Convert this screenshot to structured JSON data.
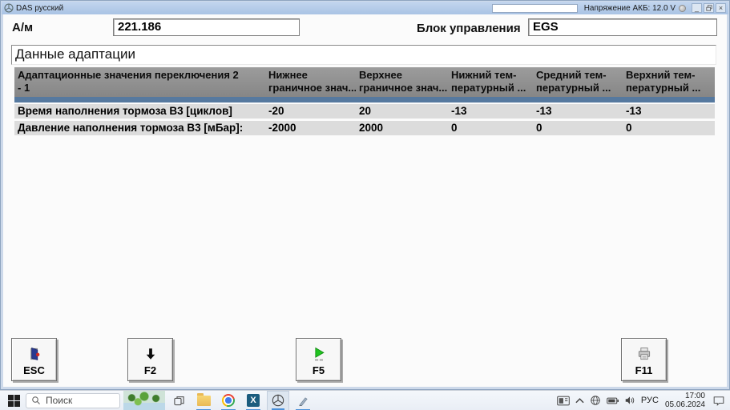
{
  "window": {
    "title": "DAS русский",
    "voltage": "Напряжение АКБ: 12.0 V",
    "minimize": "_",
    "close": "×"
  },
  "form": {
    "vehicle_label": "А/м",
    "vehicle_value": "221.186",
    "ecu_label": "Блок управления",
    "ecu_value": "EGS"
  },
  "page_title": "Данные адаптации",
  "table": {
    "columns": [
      {
        "line1": "Адаптационные значения переключения 2",
        "line2": "- 1"
      },
      {
        "line1": "Нижнее",
        "line2": "граничное знач..."
      },
      {
        "line1": "Верхнее",
        "line2": "граничное знач..."
      },
      {
        "line1": "Нижний тем-",
        "line2": "пературный ..."
      },
      {
        "line1": "Средний тем-",
        "line2": "пературный ..."
      },
      {
        "line1": "Верхний тем-",
        "line2": "пературный ..."
      }
    ],
    "rows": [
      {
        "name": "Время наполнения тормоза В3 [циклов]",
        "values": [
          "-20",
          "20",
          "-13",
          "-13",
          "-13"
        ]
      },
      {
        "name": "Давление наполнения тормоза В3 [мБар]:",
        "values": [
          "-2000",
          "2000",
          "0",
          "0",
          "0"
        ]
      }
    ]
  },
  "buttons": [
    {
      "key": "ESC",
      "icon": "exit-door-icon"
    },
    {
      "key": "F2",
      "icon": "down-arrow-icon"
    },
    {
      "key": "F5",
      "icon": "play-icon"
    },
    {
      "key": "F11",
      "icon": "printer-icon"
    }
  ],
  "taskbar": {
    "search_placeholder": "Поиск",
    "language": "РУС",
    "time": "17:00",
    "date": "05.06.2024"
  },
  "colors": {
    "titlebar_blue": "#b3c9e7",
    "selection_blue": "#56799f",
    "table_header_gray": "#8c8c8c",
    "row_gray": "#dcdcdc",
    "taskbar_underline": "#4a90d9"
  }
}
